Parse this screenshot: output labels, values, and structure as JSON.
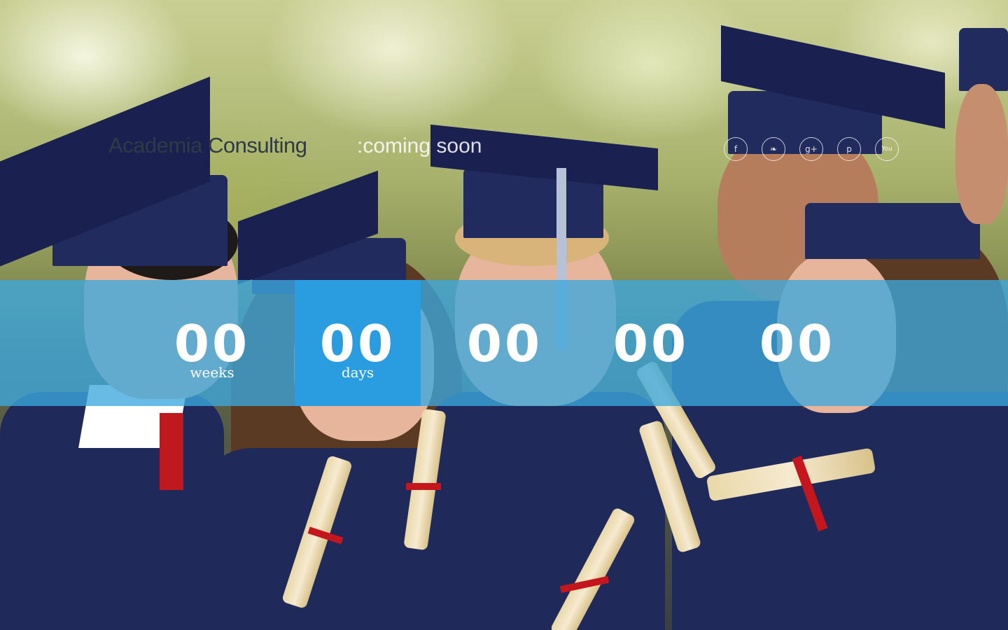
{
  "header": {
    "brand": "Academia Consulting",
    "tagline": ":coming soon"
  },
  "social": [
    {
      "icon": "facebook-icon",
      "glyph": "f"
    },
    {
      "icon": "twitter-icon",
      "glyph": "❧"
    },
    {
      "icon": "google-plus-icon",
      "glyph": "g+"
    },
    {
      "icon": "pinterest-icon",
      "glyph": "p"
    },
    {
      "icon": "youtube-icon",
      "glyph": "You"
    }
  ],
  "countdown": {
    "weeks": {
      "value": "00",
      "label": "weeks"
    },
    "days": {
      "value": "00",
      "label": "days"
    },
    "hours": {
      "value": "00"
    },
    "minutes": {
      "value": "00"
    },
    "seconds": {
      "value": "00"
    }
  },
  "colors": {
    "band": "#3ca8de",
    "active_cell": "#2a9de0",
    "brand_text": "#2f3a45"
  }
}
